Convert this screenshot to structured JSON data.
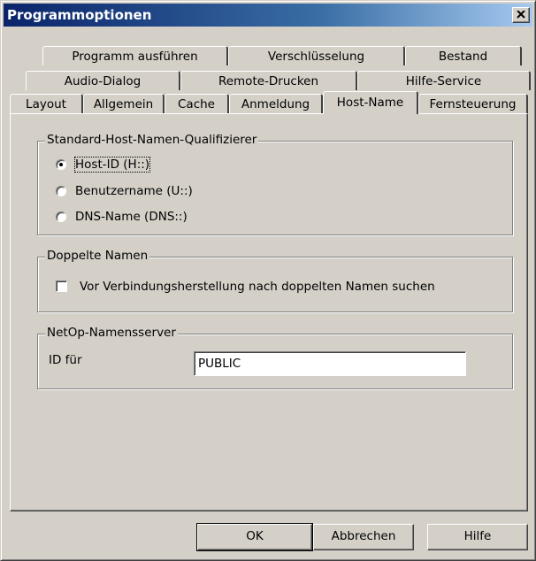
{
  "window": {
    "title": "Programmoptionen"
  },
  "tabs": {
    "row1": [
      {
        "label": "Programm ausführen"
      },
      {
        "label": "Verschlüsselung"
      },
      {
        "label": "Bestand"
      }
    ],
    "row2": [
      {
        "label": "Audio-Dialog"
      },
      {
        "label": "Remote-Drucken"
      },
      {
        "label": "Hilfe-Service"
      }
    ],
    "row3": [
      {
        "label": "Layout"
      },
      {
        "label": "Allgemein"
      },
      {
        "label": "Cache"
      },
      {
        "label": "Anmeldung"
      },
      {
        "label": "Host-Name"
      },
      {
        "label": "Fernsteuerung"
      }
    ],
    "selected": "Host-Name"
  },
  "host_qualifier": {
    "legend": "Standard-Host-Namen-Qualifizierer",
    "options": [
      {
        "label": "Host-ID (H::)",
        "selected": true
      },
      {
        "label": "Benutzername (U::)",
        "selected": false
      },
      {
        "label": "DNS-Name (DNS::)",
        "selected": false
      }
    ]
  },
  "duplicate_names": {
    "legend": "Doppelte Namen",
    "checkbox_label": "Vor Verbindungsherstellung nach doppelten Namen suchen",
    "checked": false
  },
  "name_server": {
    "legend": "NetOp-Namensserver",
    "id_label": "ID für",
    "id_value": "PUBLIC"
  },
  "buttons": {
    "ok": "OK",
    "cancel": "Abbrechen",
    "help": "Hilfe"
  }
}
